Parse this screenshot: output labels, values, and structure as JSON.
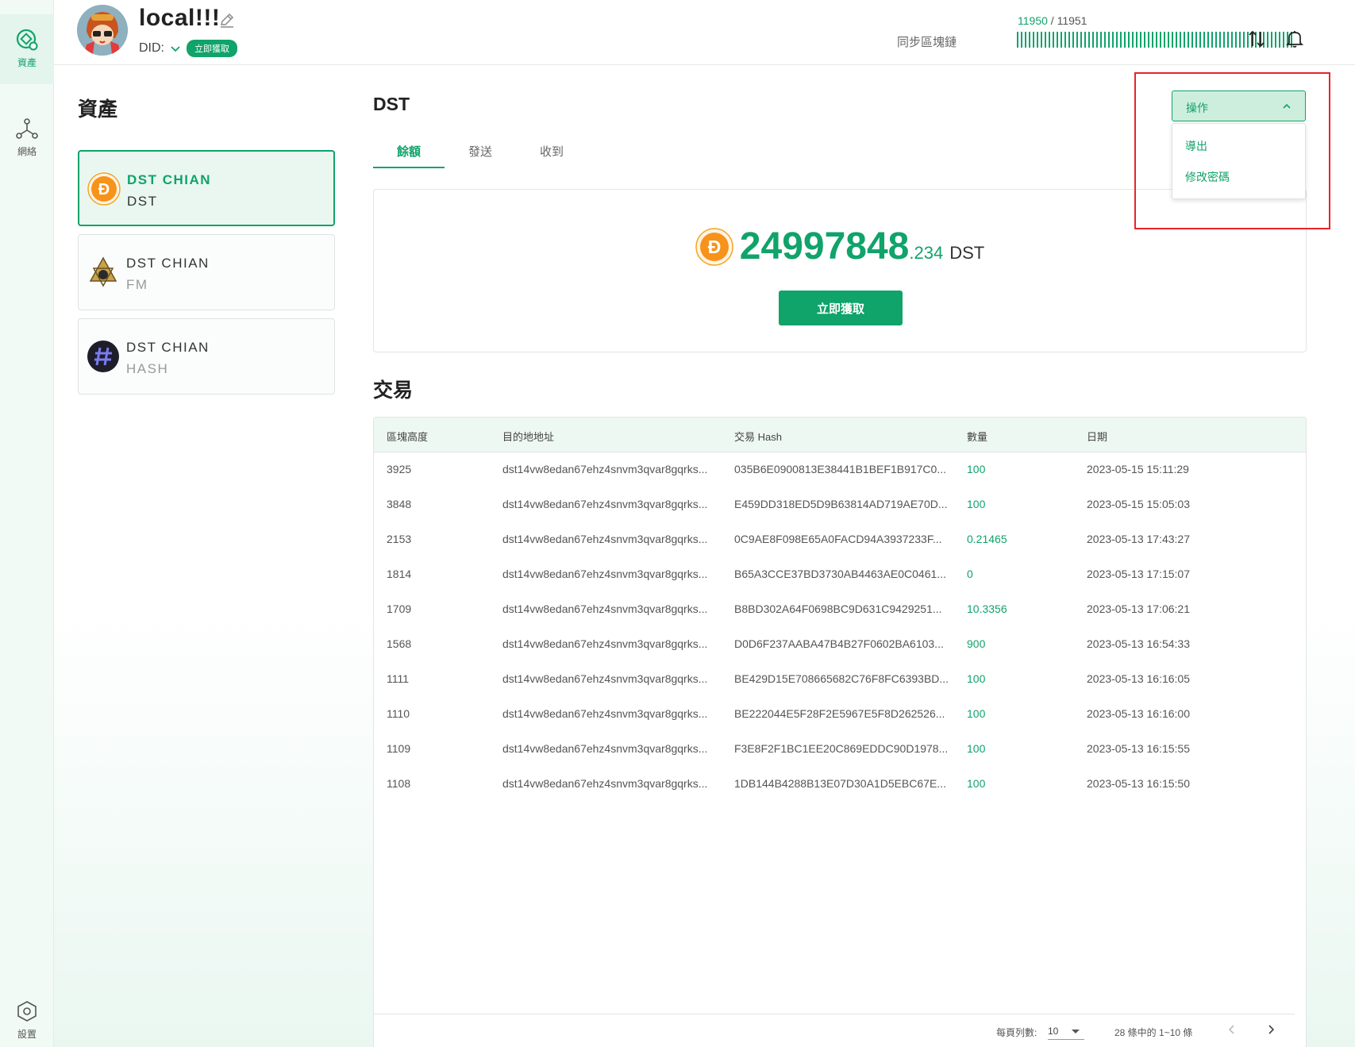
{
  "rail": {
    "assets_label": "資產",
    "network_label": "網絡",
    "settings_label": "設置"
  },
  "header": {
    "wallet_name": "local!!!",
    "did_label": "DID:",
    "did_badge": "立即獲取",
    "sync_current": "11950",
    "sync_separator": " / ",
    "sync_total": "11951",
    "sync_label": "同步區塊鏈"
  },
  "sidebar": {
    "title": "資產",
    "assets": [
      {
        "name": "DST CHIAN",
        "symbol": "DST",
        "icon": "dst-coin-icon"
      },
      {
        "name": "DST CHIAN",
        "symbol": "FM",
        "icon": "fm-emblem-icon"
      },
      {
        "name": "DST CHIAN",
        "symbol": "HASH",
        "icon": "hash-icon"
      }
    ]
  },
  "main": {
    "asset_title": "DST",
    "tabs": [
      {
        "label": "餘額"
      },
      {
        "label": "發送"
      },
      {
        "label": "收到"
      }
    ],
    "balance": {
      "integer": "24997848",
      "decimal": ".234",
      "unit": "DST",
      "claim_label": "立即獲取"
    }
  },
  "actions": {
    "button_label": "操作",
    "menu": [
      {
        "label": "導出"
      },
      {
        "label": "修改密碼"
      }
    ]
  },
  "transactions": {
    "title": "交易",
    "columns": [
      "區塊高度",
      "目的地地址",
      "交易 Hash",
      "數量",
      "日期"
    ],
    "rows": [
      {
        "height": "3925",
        "address": "dst14vw8edan67ehz4snvm3qvar8gqrks...",
        "hash": "035B6E0900813E38441B1BEF1B917C0...",
        "amount": "100",
        "date": "2023-05-15 15:11:29"
      },
      {
        "height": "3848",
        "address": "dst14vw8edan67ehz4snvm3qvar8gqrks...",
        "hash": "E459DD318ED5D9B63814AD719AE70D...",
        "amount": "100",
        "date": "2023-05-15 15:05:03"
      },
      {
        "height": "2153",
        "address": "dst14vw8edan67ehz4snvm3qvar8gqrks...",
        "hash": "0C9AE8F098E65A0FACD94A3937233F...",
        "amount": "0.21465",
        "date": "2023-05-13 17:43:27"
      },
      {
        "height": "1814",
        "address": "dst14vw8edan67ehz4snvm3qvar8gqrks...",
        "hash": "B65A3CCE37BD3730AB4463AE0C0461...",
        "amount": "0",
        "date": "2023-05-13 17:15:07"
      },
      {
        "height": "1709",
        "address": "dst14vw8edan67ehz4snvm3qvar8gqrks...",
        "hash": "B8BD302A64F0698BC9D631C9429251...",
        "amount": "10.3356",
        "date": "2023-05-13 17:06:21"
      },
      {
        "height": "1568",
        "address": "dst14vw8edan67ehz4snvm3qvar8gqrks...",
        "hash": "D0D6F237AABA47B4B27F0602BA6103...",
        "amount": "900",
        "date": "2023-05-13 16:54:33"
      },
      {
        "height": "1111",
        "address": "dst14vw8edan67ehz4snvm3qvar8gqrks...",
        "hash": "BE429D15E708665682C76F8FC6393BD...",
        "amount": "100",
        "date": "2023-05-13 16:16:05"
      },
      {
        "height": "1110",
        "address": "dst14vw8edan67ehz4snvm3qvar8gqrks...",
        "hash": "BE222044E5F28F2E5967E5F8D262526...",
        "amount": "100",
        "date": "2023-05-13 16:16:00"
      },
      {
        "height": "1109",
        "address": "dst14vw8edan67ehz4snvm3qvar8gqrks...",
        "hash": "F3E8F2F1BC1EE20C869EDDC90D1978...",
        "amount": "100",
        "date": "2023-05-13 16:15:55"
      },
      {
        "height": "1108",
        "address": "dst14vw8edan67ehz4snvm3qvar8gqrks...",
        "hash": "1DB144B4288B13E07D30A1D5EBC67E...",
        "amount": "100",
        "date": "2023-05-13 16:15:50"
      }
    ],
    "pagination": {
      "per_page_label": "每頁列數:",
      "per_page_value": "10",
      "range_text": "28 條中的 1~10 條"
    }
  },
  "colors": {
    "accent": "#10a36a",
    "highlight": "#e8252a"
  }
}
